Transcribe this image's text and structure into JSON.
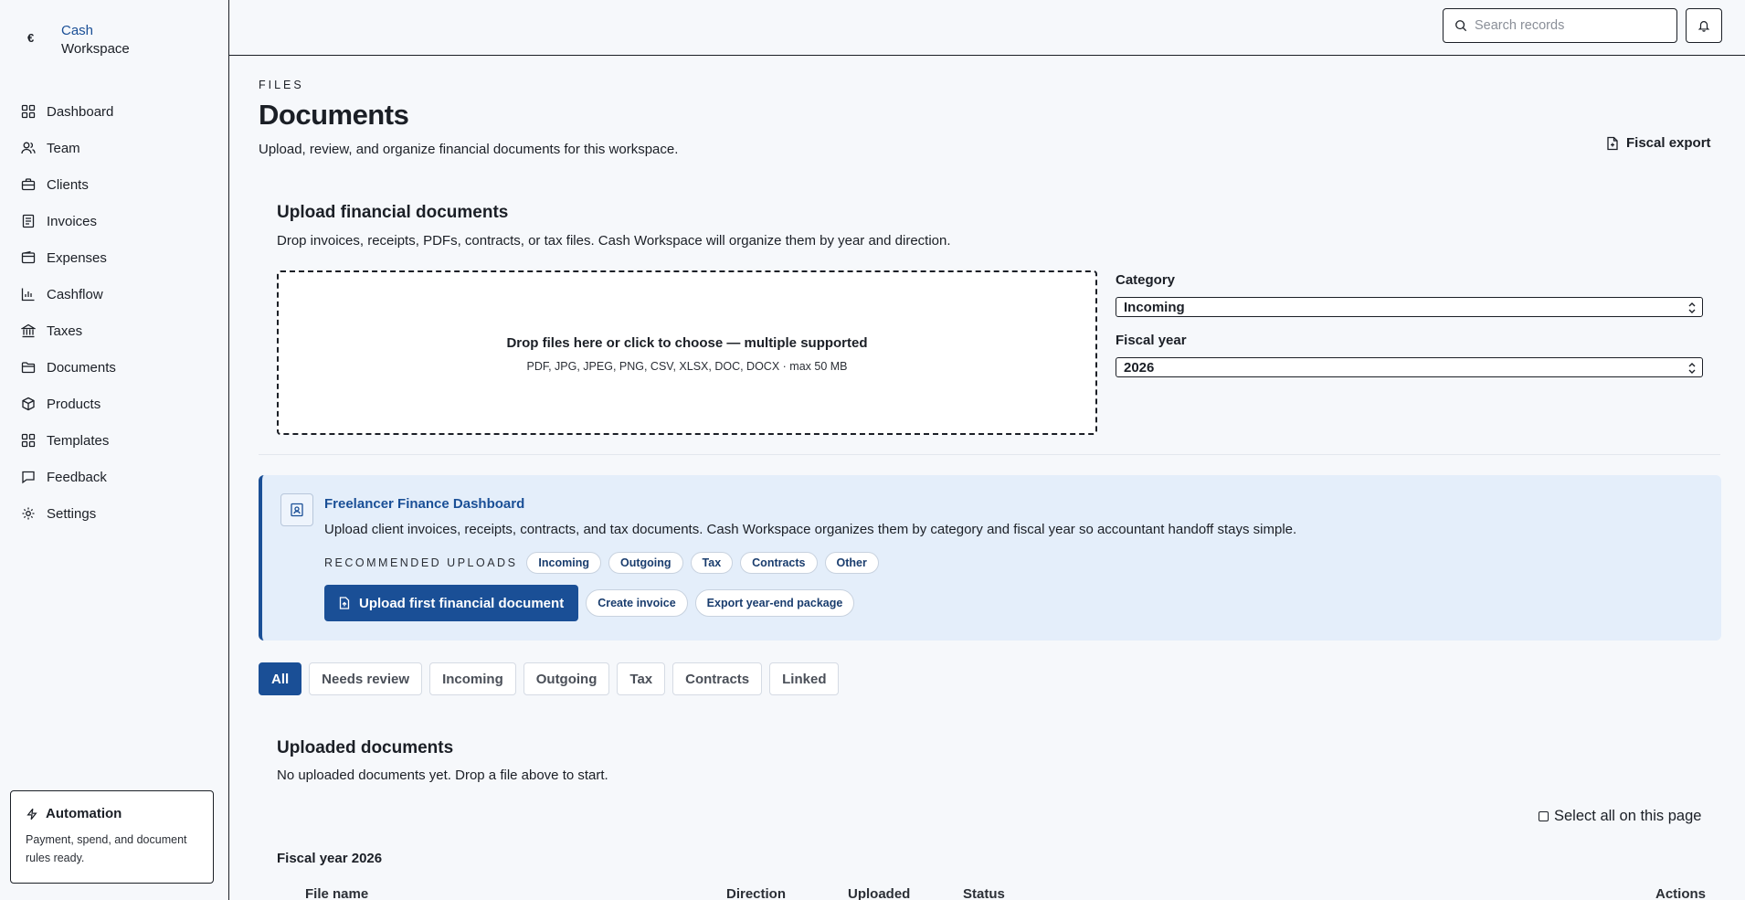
{
  "brand": {
    "mark": "€",
    "name": "Cash",
    "sub": "Workspace"
  },
  "sidebar": {
    "items": [
      {
        "label": "Dashboard",
        "icon": "grid-icon"
      },
      {
        "label": "Team",
        "icon": "users-icon"
      },
      {
        "label": "Clients",
        "icon": "briefcase-icon"
      },
      {
        "label": "Invoices",
        "icon": "receipt-icon"
      },
      {
        "label": "Expenses",
        "icon": "wallet-icon"
      },
      {
        "label": "Cashflow",
        "icon": "bar-chart-icon"
      },
      {
        "label": "Taxes",
        "icon": "landmark-icon"
      },
      {
        "label": "Documents",
        "icon": "folder-icon"
      },
      {
        "label": "Products",
        "icon": "package-icon"
      },
      {
        "label": "Templates",
        "icon": "layout-icon"
      },
      {
        "label": "Feedback",
        "icon": "message-icon"
      },
      {
        "label": "Settings",
        "icon": "gear-icon"
      }
    ],
    "automation": {
      "title": "Automation",
      "description": "Payment, spend, and document rules ready."
    }
  },
  "header": {
    "search_placeholder": "Search records"
  },
  "page": {
    "eyebrow": "FILES",
    "title": "Documents",
    "subtitle": "Upload, review, and organize financial documents for this workspace.",
    "fiscal_export": "Fiscal export"
  },
  "upload": {
    "title": "Upload financial documents",
    "subtitle": "Drop invoices, receipts, PDFs, contracts, or tax files. Cash Workspace will organize them by year and direction.",
    "dropzone_main": "Drop files here or click to choose — multiple supported",
    "dropzone_sub": "PDF, JPG, JPEG, PNG, CSV, XLSX, DOC, DOCX · max 50 MB",
    "category_label": "Category",
    "category_value": "Incoming",
    "year_label": "Fiscal year",
    "year_value": "2026"
  },
  "banner": {
    "title": "Freelancer Finance Dashboard",
    "description": "Upload client invoices, receipts, contracts, and tax documents. Cash Workspace organizes them by category and fiscal year so accountant handoff stays simple.",
    "recommended_label": "RECOMMENDED UPLOADS",
    "chips": [
      "Incoming",
      "Outgoing",
      "Tax",
      "Contracts",
      "Other"
    ],
    "primary_action": "Upload first financial document",
    "secondary_actions": [
      "Create invoice",
      "Export year-end package"
    ]
  },
  "filters": {
    "tabs": [
      "All",
      "Needs review",
      "Incoming",
      "Outgoing",
      "Tax",
      "Contracts",
      "Linked"
    ],
    "active": "All"
  },
  "documents": {
    "title": "Uploaded documents",
    "empty_text": "No uploaded documents yet. Drop a file above to start.",
    "select_all": "Select all on this page",
    "group_label": "Fiscal year 2026",
    "columns": [
      "File name",
      "Direction",
      "Uploaded",
      "Status",
      "Actions"
    ]
  },
  "colors": {
    "accent": "#1a4f96",
    "banner_bg": "#e4eefa",
    "page_bg": "#f6f8fb"
  }
}
